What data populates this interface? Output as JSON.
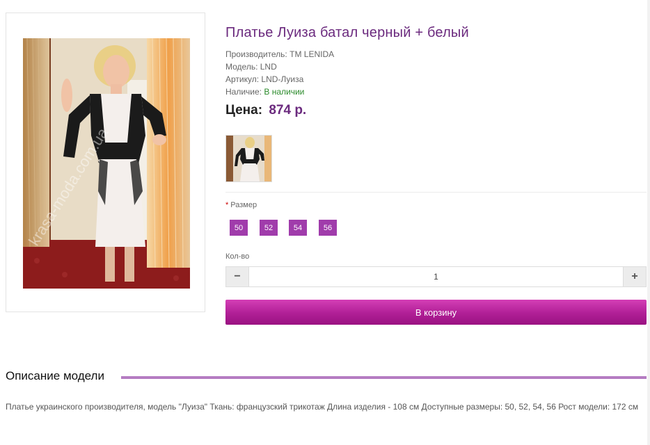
{
  "product": {
    "title": "Платье Луиза батал черный + белый",
    "manufacturer_label": "Производитель:",
    "manufacturer_value": "ТМ LENIDA",
    "model_label": "Модель:",
    "model_value": "LND",
    "sku_label": "Артикул:",
    "sku_value": "LND-Луиза",
    "stock_label": "Наличие:",
    "stock_value": "В наличии",
    "price_label": "Цена:",
    "price_value": "874 р."
  },
  "image": {
    "watermark": "krasa-moda.com.ua"
  },
  "sizes": {
    "label": "Размер",
    "required_mark": "*",
    "options": [
      "50",
      "52",
      "54",
      "56"
    ]
  },
  "quantity": {
    "label": "Кол-во",
    "value": "1",
    "minus": "−",
    "plus": "+"
  },
  "cart": {
    "button_label": "В корзину"
  },
  "description": {
    "heading": "Описание модели",
    "text": "Платье украинского производителя, модель \"Луиза\" Ткань: французский трикотаж Длина изделия - 108 см Доступные размеры: 50, 52, 54, 56 Рост модели: 172 см"
  },
  "colors": {
    "accent": "#a03cab",
    "title": "#6b2a7e",
    "cart_button": "#b01f96",
    "stock": "#2a8a2a"
  }
}
